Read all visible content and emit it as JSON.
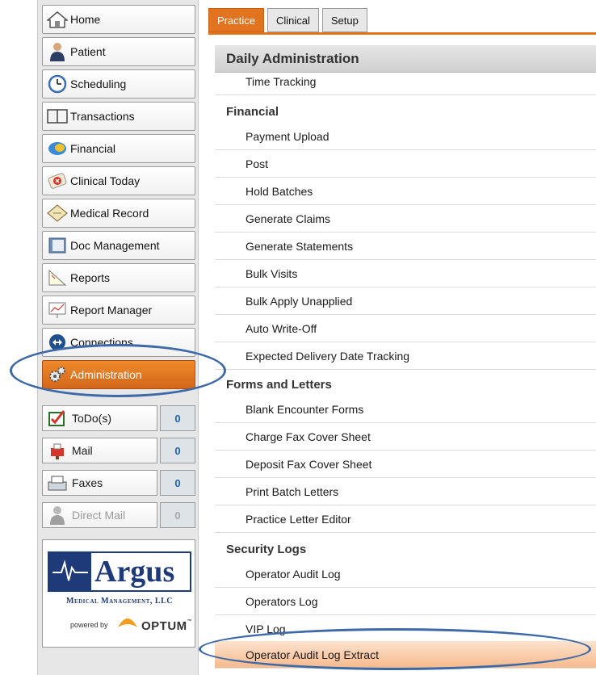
{
  "sidebar": {
    "items": [
      {
        "label": "Home",
        "icon": "home-icon"
      },
      {
        "label": "Patient",
        "icon": "patient-icon"
      },
      {
        "label": "Scheduling",
        "icon": "clock-icon"
      },
      {
        "label": "Transactions",
        "icon": "ledger-icon"
      },
      {
        "label": "Financial",
        "icon": "financial-icon"
      },
      {
        "label": "Clinical Today",
        "icon": "clinical-today-icon"
      },
      {
        "label": "Medical Record",
        "icon": "medical-record-icon"
      },
      {
        "label": "Doc Management",
        "icon": "folder-icon"
      },
      {
        "label": "Reports",
        "icon": "reports-icon"
      },
      {
        "label": "Report Manager",
        "icon": "report-manager-icon"
      },
      {
        "label": "Connections",
        "icon": "connections-icon"
      },
      {
        "label": "Administration",
        "icon": "gears-icon"
      }
    ],
    "counters": [
      {
        "label": "ToDo(s)",
        "count": "0",
        "icon": "todo-icon"
      },
      {
        "label": "Mail",
        "count": "0",
        "icon": "mailbox-icon"
      },
      {
        "label": "Faxes",
        "count": "0",
        "icon": "fax-icon"
      },
      {
        "label": "Direct Mail",
        "count": "0",
        "icon": "direct-mail-icon"
      }
    ],
    "logo": {
      "argus": "Argus",
      "company": "Medical Management, LLC",
      "powered_by": "powered by",
      "optum": "OPTUM",
      "tm": "™"
    }
  },
  "tabs": [
    "Practice",
    "Clinical",
    "Setup"
  ],
  "main": {
    "section_title": "Daily Administration",
    "time_tracking": "Time Tracking",
    "financial_heading": "Financial",
    "financial_items": [
      "Payment Upload",
      "Post",
      "Hold Batches",
      "Generate Claims",
      "Generate Statements",
      "Bulk Visits",
      "Bulk Apply Unapplied",
      "Auto Write-Off",
      "Expected Delivery Date Tracking"
    ],
    "forms_heading": "Forms and Letters",
    "forms_items": [
      "Blank Encounter Forms",
      "Charge Fax Cover Sheet",
      "Deposit Fax Cover Sheet",
      "Print Batch Letters",
      "Practice Letter Editor"
    ],
    "security_heading": "Security Logs",
    "security_items": [
      "Operator Audit Log",
      "Operators Log",
      "VIP Log",
      "Operator Audit Log Extract"
    ]
  },
  "colors": {
    "accent": "#e2731f",
    "highlight": "#f6b98c",
    "annotation": "#3d6aa6",
    "badge_text": "#1c64b8"
  }
}
